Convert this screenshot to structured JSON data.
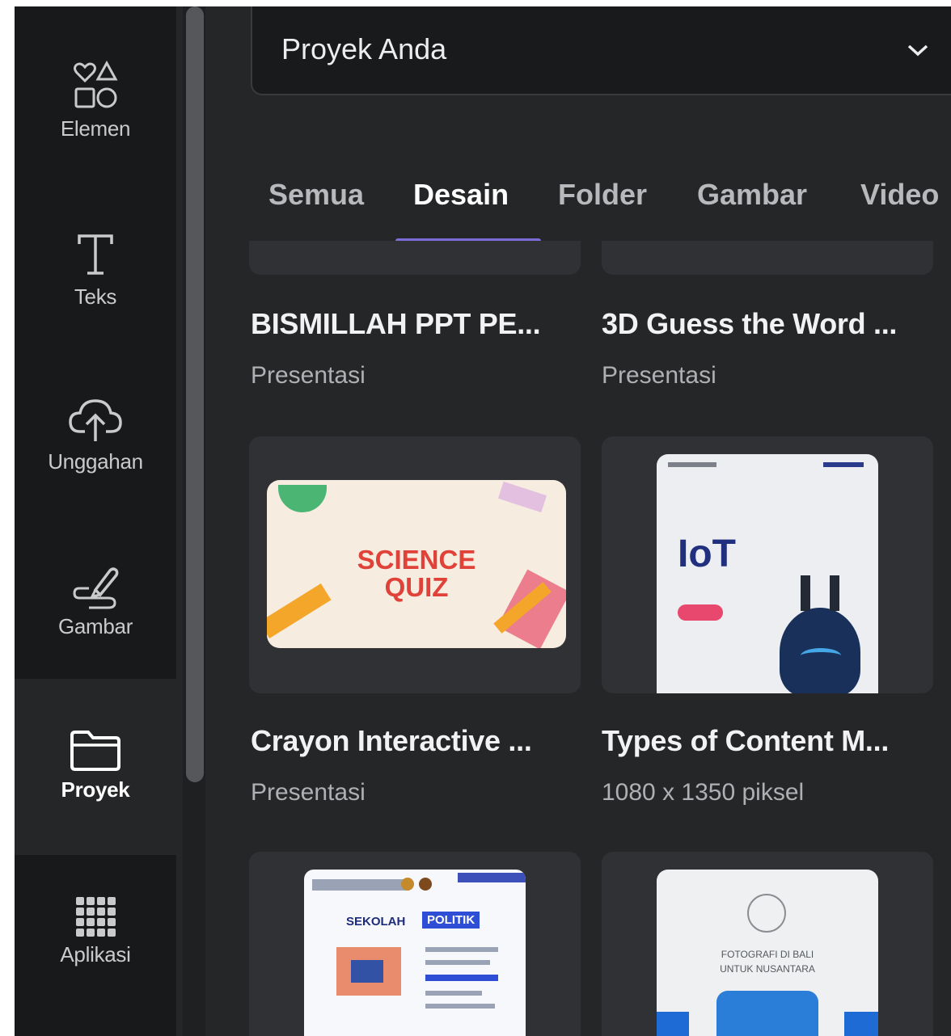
{
  "sidebar": {
    "items": [
      {
        "label": "Elemen",
        "icon": "elements-icon"
      },
      {
        "label": "Teks",
        "icon": "text-icon"
      },
      {
        "label": "Unggahan",
        "icon": "cloud-upload-icon"
      },
      {
        "label": "Gambar",
        "icon": "draw-icon"
      },
      {
        "label": "Proyek",
        "icon": "folder-icon",
        "active": true
      },
      {
        "label": "Aplikasi",
        "icon": "apps-grid-icon"
      }
    ]
  },
  "dropdown": {
    "label": "Proyek Anda",
    "icon": "chevron-down-icon"
  },
  "tabs": [
    {
      "label": "Semua"
    },
    {
      "label": "Desain",
      "active": true
    },
    {
      "label": "Folder"
    },
    {
      "label": "Gambar"
    },
    {
      "label": "Video"
    }
  ],
  "designs": [
    {
      "title": "BISMILLAH PPT PE...",
      "subtitle": "Presentasi"
    },
    {
      "title": "3D Guess the Word ...",
      "subtitle": "Presentasi"
    },
    {
      "title": "Crayon Interactive ...",
      "subtitle": "Presentasi",
      "thumb_text": [
        "SCIENCE",
        "QUIZ"
      ]
    },
    {
      "title": "Types of Content M...",
      "subtitle": "1080 x 1350 piksel",
      "thumb_text": [
        "IoT"
      ]
    },
    {
      "thumb_text": [
        "SEKOLAH",
        "POLITIK"
      ]
    },
    {
      "thumb_text": [
        "FOTOGRAFI DI BALI",
        "UNTUK NUSANTARA"
      ]
    }
  ],
  "colors": {
    "accent": "#7d6bd8",
    "panel": "#252627",
    "rail": "#18191b"
  }
}
